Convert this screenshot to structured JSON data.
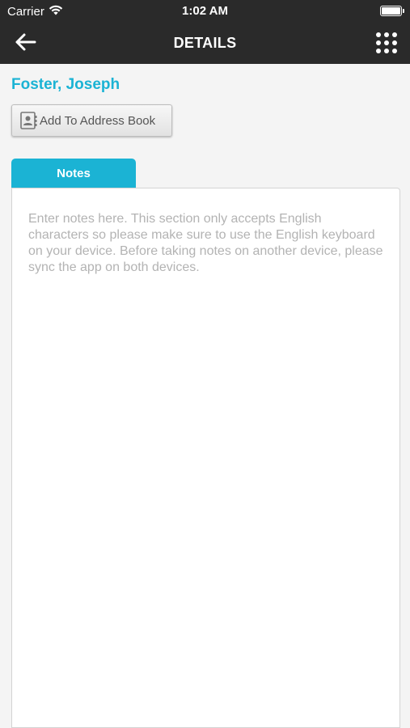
{
  "status_bar": {
    "carrier": "Carrier",
    "time": "1:02 AM",
    "wifi_icon": "wifi-icon",
    "battery_icon": "battery-icon"
  },
  "nav": {
    "title": "DETAILS",
    "back_icon": "back-arrow-icon",
    "menu_icon": "app-grid-icon"
  },
  "contact": {
    "name": "Foster, Joseph"
  },
  "actions": {
    "add_to_address_book": "Add To Address Book",
    "add_to_address_book_icon": "contact-card-icon"
  },
  "tabs": [
    {
      "label": "Notes",
      "active": true
    }
  ],
  "notes": {
    "value": "",
    "placeholder": "Enter notes here. This section only accepts English characters so please make sure to use the English keyboard on your device. Before taking notes on another device, please sync the app on both devices."
  },
  "colors": {
    "accent": "#1bb3d4",
    "topbar": "#2a2a2a",
    "background": "#f4f4f4"
  }
}
